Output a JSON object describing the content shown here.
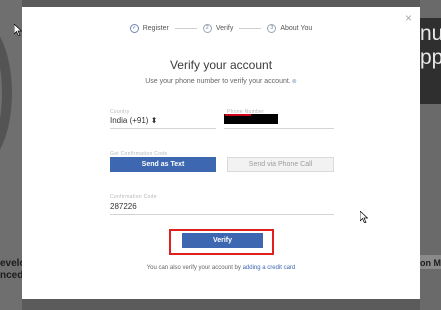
{
  "background": {
    "left_text": "evelo\nnced",
    "right_big": "nu\npp",
    "right_text": "on M"
  },
  "modal": {
    "close_glyph": "×",
    "steps": [
      {
        "label": "Register",
        "state": "done"
      },
      {
        "label": "Verify",
        "number": "2",
        "state": "current"
      },
      {
        "label": "About You",
        "number": "3",
        "state": "pending"
      }
    ],
    "title": "Verify your account",
    "subtitle": "Use your phone number to verify your account.",
    "country": {
      "label": "Country",
      "value": "India (+91) ⬍"
    },
    "phone": {
      "label": "Phone Number",
      "value": ""
    },
    "get_code": {
      "label": "Get Confirmation Code",
      "send_text": "Send as Text",
      "send_call": "Send via Phone Call"
    },
    "confirmation": {
      "label": "Confirmation Code",
      "value": "287226"
    },
    "verify_button": "Verify",
    "footer_text": "You can also verify your account by ",
    "footer_link": "adding a credit card"
  },
  "colors": {
    "primary": "#3e67b1",
    "highlight": "#e01f1f"
  }
}
